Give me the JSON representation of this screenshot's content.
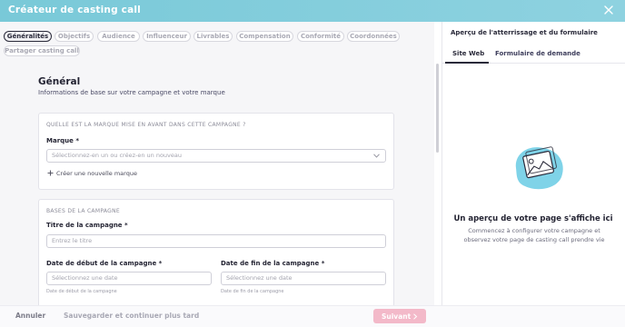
{
  "header": {
    "title": "Créateur de casting call"
  },
  "steps": [
    {
      "label": "Généralités",
      "active": true
    },
    {
      "label": "Objectifs"
    },
    {
      "label": "Audience"
    },
    {
      "label": "Influenceur"
    },
    {
      "label": "Livrables"
    },
    {
      "label": "Compensation"
    },
    {
      "label": "Conformité"
    },
    {
      "label": "Coordonnées"
    },
    {
      "label": "Partager casting call"
    }
  ],
  "general": {
    "title": "Général",
    "subtitle": "Informations de base sur votre campagne et votre marque"
  },
  "brand_card": {
    "heading": "QUELLE EST LA MARQUE MISE EN AVANT DANS CETTE CAMPAGNE ?",
    "brand_label": "Marque *",
    "brand_placeholder": "Sélectionnez-en un ou créez-en un nouveau",
    "create_link": "Créer une nouvelle marque"
  },
  "basics_card": {
    "heading": "BASES DE LA CAMPAGNE",
    "title_label": "Titre de la campagne *",
    "title_placeholder": "Entrez le titre",
    "start_label": "Date de début de la campagne *",
    "start_placeholder": "Sélectionnez une date",
    "start_helper": "Date de début de la campagne",
    "end_label": "Date de fin de la campagne *",
    "end_placeholder": "Sélectionnez une date",
    "end_helper": "Date de fin de la campagne"
  },
  "footer": {
    "cancel": "Annuler",
    "save_later": "Sauvegarder et continuer plus tard",
    "next": "Suivant"
  },
  "preview": {
    "title": "Aperçu de l'atterrissage et du formulaire",
    "tab_site": "Site Web",
    "tab_form": "Formulaire de demande",
    "empty_title": "Un aperçu de votre page s'affiche ici",
    "empty_text": "Commencez à configurer votre campagne et observez votre page de casting call prendre vie"
  },
  "colors": {
    "header": "#79c9d8",
    "next_button": "#f3b9c9",
    "illustration": "#7fd3e8"
  }
}
